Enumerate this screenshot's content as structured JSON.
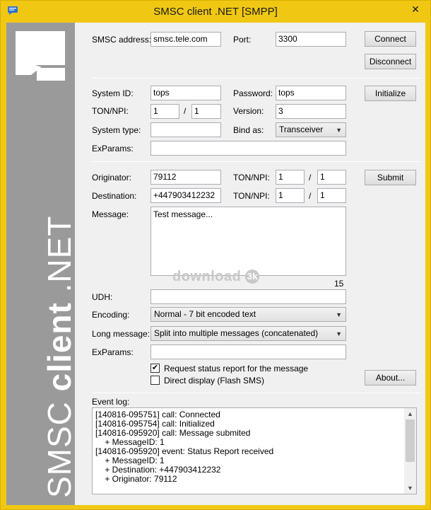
{
  "window": {
    "title": "SMSC client .NET [SMPP]",
    "close_glyph": "✕",
    "accent": "#f0c814"
  },
  "sidebar": {
    "text_light": "SMSC ",
    "text_bold": "client",
    "text_tail": " .NET"
  },
  "connection": {
    "address_label": "SMSC address:",
    "address_value": "smsc.tele.com",
    "port_label": "Port:",
    "port_value": "3300",
    "connect": "Connect",
    "disconnect": "Disconnect"
  },
  "bind": {
    "system_id_label": "System ID:",
    "system_id_value": "tops",
    "password_label": "Password:",
    "password_value": "tops",
    "ton_npi_label": "TON/NPI:",
    "ton_value": "1",
    "npi_value": "1",
    "version_label": "Version:",
    "version_value": "3",
    "system_type_label": "System type:",
    "system_type_value": "",
    "bind_as_label": "Bind as:",
    "bind_as_value": "Transceiver",
    "exparams_label": "ExParams:",
    "exparams_value": "",
    "initialize": "Initialize",
    "slash": "/"
  },
  "message": {
    "originator_label": "Originator:",
    "originator_value": "79112",
    "orig_ton_label": "TON/NPI:",
    "orig_ton": "1",
    "orig_npi": "1",
    "destination_label": "Destination:",
    "destination_value": "+447903412232",
    "dest_ton_label": "TON/NPI:",
    "dest_ton": "1",
    "dest_npi": "1",
    "message_label": "Message:",
    "message_value": "Test message...",
    "char_count": "15",
    "udh_label": "UDH:",
    "udh_value": "",
    "encoding_label": "Encoding:",
    "encoding_value": "Normal - 7 bit encoded text",
    "long_label": "Long message:",
    "long_value": "Split into multiple messages (concatenated)",
    "exparams_label": "ExParams:",
    "exparams_value": "",
    "status_report_label": "Request status report for the message",
    "status_report_checked": true,
    "flash_label": "Direct display (Flash SMS)",
    "flash_checked": false,
    "submit": "Submit",
    "about": "About..."
  },
  "watermark": {
    "text": "download",
    "badge": "3k"
  },
  "eventlog": {
    "label": "Event log:",
    "lines": [
      "[140816-095751] call: Connected",
      "[140816-095754] call: Initialized",
      "[140816-095920] call: Message submited",
      "    + MessageID: 1",
      "[140816-095920] event: Status Report received",
      "    + MessageID: 1",
      "    + Destination: +447903412232",
      "    + Originator: 79112"
    ]
  }
}
